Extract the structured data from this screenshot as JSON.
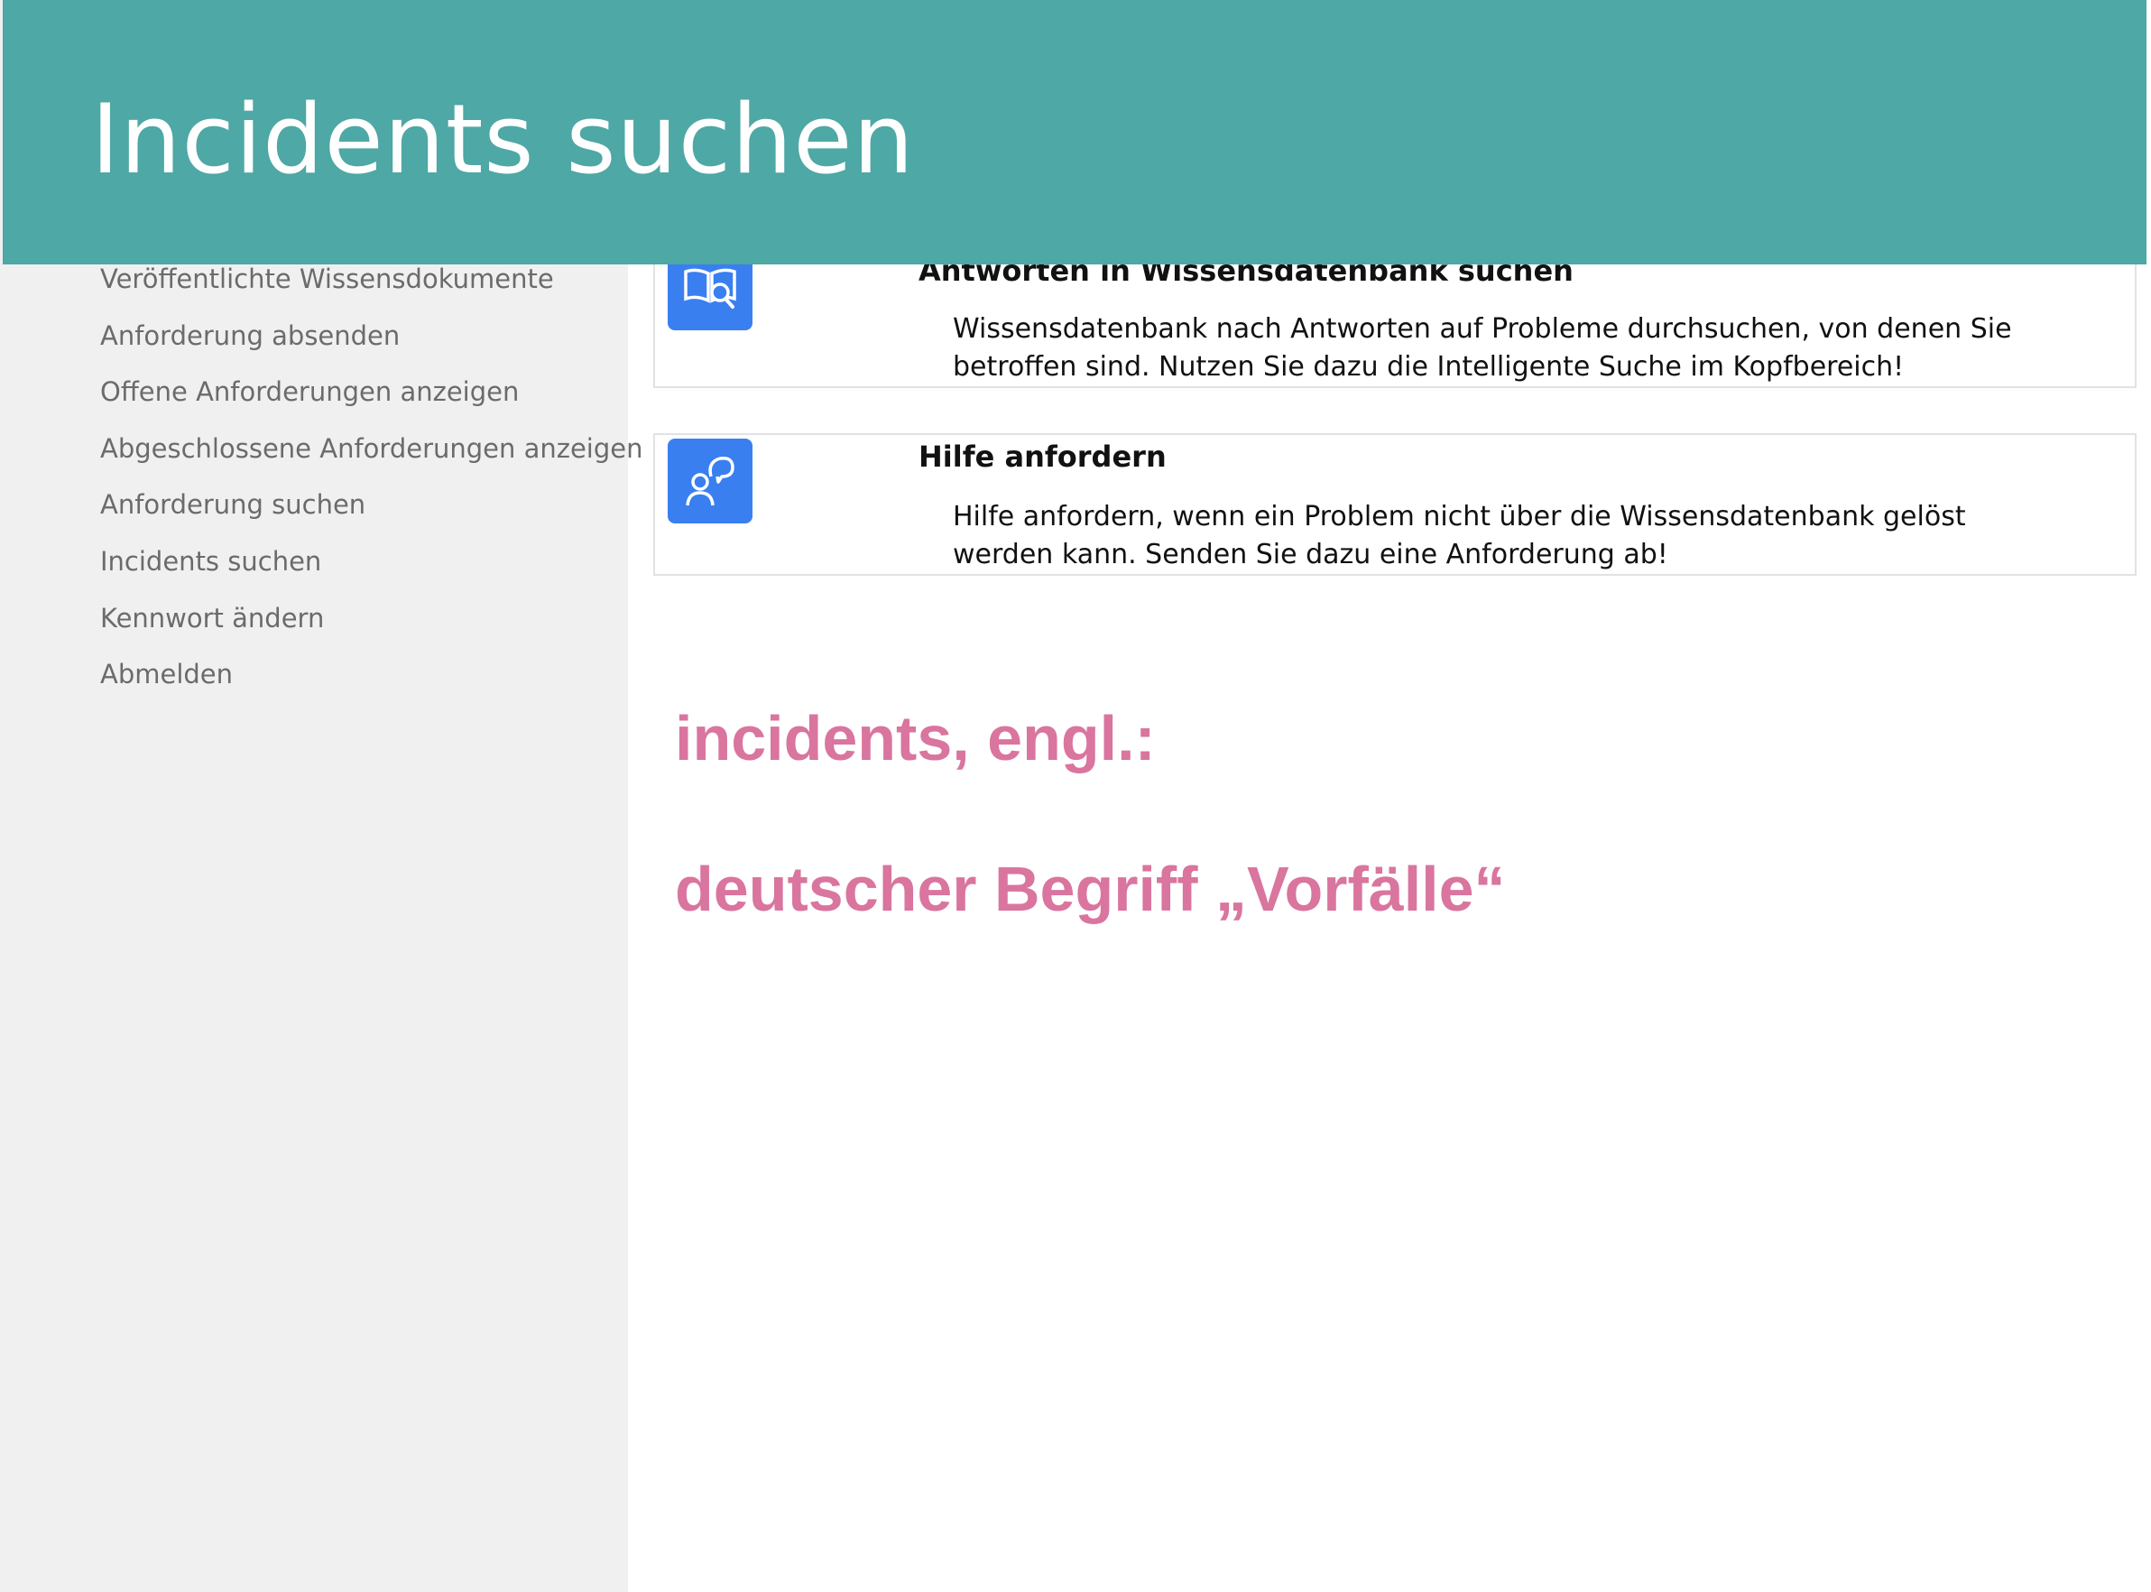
{
  "header": {
    "title": "Incidents suchen"
  },
  "sidebar": {
    "items": [
      {
        "label": "Veröffentlichte Wissensdokumente"
      },
      {
        "label": "Anforderung absenden"
      },
      {
        "label": "Offene Anforderungen anzeigen"
      },
      {
        "label": "Abgeschlossene Anforderungen anzeigen"
      },
      {
        "label": "Anforderung suchen"
      },
      {
        "label": "Incidents suchen"
      },
      {
        "label": "Kennwort ändern"
      },
      {
        "label": "Abmelden"
      }
    ]
  },
  "cards": [
    {
      "icon": "book-search-icon",
      "title": "Antworten in Wissensdatenbank suchen",
      "description": "Wissensdatenbank nach Antworten auf Probleme durchsuchen, von denen Sie betroffen sind. Nutzen Sie dazu die Intelligente Suche im Kopfbereich!"
    },
    {
      "icon": "person-help-icon",
      "title": "Hilfe anfordern",
      "description": "Hilfe anfordern, wenn ein Problem nicht über die Wissensdatenbank gelöst werden kann. Senden Sie dazu eine Anforderung ab!"
    }
  ],
  "notes": {
    "line1": "incidents, engl.:",
    "line2": "deutscher Begriff „Vorfälle“"
  },
  "colors": {
    "header_bg": "#4ea8a5",
    "icon_bg": "#3a7ff0",
    "note_text": "#d9759e",
    "sidebar_bg": "#f0f0f0"
  }
}
